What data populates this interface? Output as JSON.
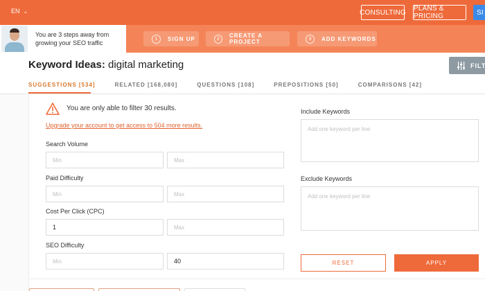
{
  "header": {
    "language": "EN",
    "consulting_label": "CONSULTING",
    "plans_label": "PLANS & PRICING",
    "signin_label": "SI"
  },
  "promo": {
    "text": "You are 3 steps away from growing your SEO traffic"
  },
  "steps": [
    {
      "num": "1",
      "label": "SIGN UP"
    },
    {
      "num": "2",
      "label": "CREATE A PROJECT"
    },
    {
      "num": "3",
      "label": "ADD KEYWORDS"
    }
  ],
  "page": {
    "title_bold": "Keyword Ideas:",
    "title_query": "digital marketing",
    "filter_label": "FILT"
  },
  "tabs": [
    {
      "label": "SUGGESTIONS [534]",
      "active": true
    },
    {
      "label": "RELATED [168,080]",
      "active": false
    },
    {
      "label": "QUESTIONS [108]",
      "active": false
    },
    {
      "label": "PREPOSITIONS [50]",
      "active": false
    },
    {
      "label": "COMPARISONS [42]",
      "active": false
    }
  ],
  "filters": {
    "warning": "You are only able to filter 30 results.",
    "upgrade_link": "Upgrade your account to get access to 504 more results.",
    "search_volume": {
      "label": "Search Volume",
      "min_placeholder": "Min",
      "max_placeholder": "Max",
      "min_value": "",
      "max_value": ""
    },
    "paid_difficulty": {
      "label": "Paid Difficulty",
      "min_placeholder": "Min",
      "max_placeholder": "Max",
      "min_value": "",
      "max_value": ""
    },
    "cpc": {
      "label": "Cost Per Click (CPC)",
      "min_placeholder": "Min",
      "max_placeholder": "Max",
      "min_value": "1",
      "max_value": ""
    },
    "seo_difficulty": {
      "label": "SEO Difficulty",
      "min_placeholder": "Min",
      "max_placeholder": "Max",
      "min_value": "",
      "max_value": "40"
    },
    "include": {
      "label": "Include Keywords",
      "placeholder": "Add one keyword per line"
    },
    "exclude": {
      "label": "Exclude Keywords",
      "placeholder": "Add one keyword per line"
    },
    "reset_label": "RESET",
    "apply_label": "APPLY"
  },
  "colors": {
    "brand_orange": "#ef6a3a",
    "steps_orange": "#f48457",
    "tab_active": "#d9772a",
    "filter_gray": "#8e9aa2",
    "signin_blue": "#3c8ae8"
  }
}
